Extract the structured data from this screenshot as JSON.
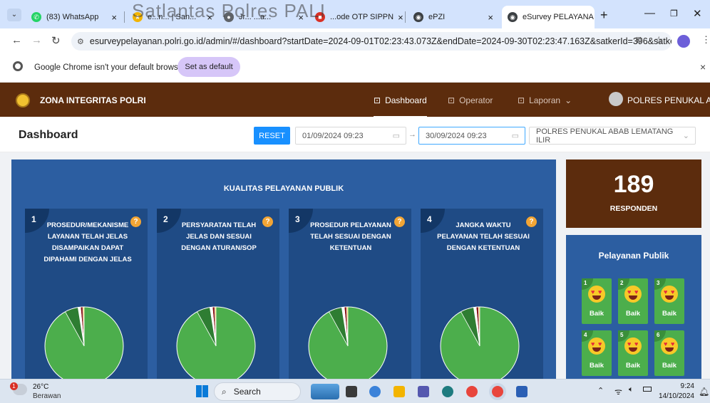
{
  "watermark": "Satlantas Polres PALI",
  "tabs": [
    {
      "title": "(83) WhatsApp",
      "color": "#25d366",
      "glyph": "✆"
    },
    {
      "title": "e...n... | San...",
      "color": "#f2b400",
      "glyph": "★"
    },
    {
      "title": "Jr... ...a...",
      "color": "#5f6368",
      "glyph": "●"
    },
    {
      "title": "...ode OTP SIPPN",
      "color": "#d93025",
      "glyph": "■"
    },
    {
      "title": "ePZI",
      "color": "#3c4043",
      "glyph": "◉"
    },
    {
      "title": "eSurvey PELAYANA",
      "color": "#3c4043",
      "glyph": "◉"
    }
  ],
  "new_tab": "+",
  "url": "esurveypelayanan.polri.go.id/admin/#/dashboard?startDate=2024-09-01T02:23:43.073Z&endDate=2024-09-30T02:23:47.163Z&satkerId=396&satkerNam...",
  "infobar": {
    "message": "Google Chrome isn't your default browser",
    "button": "Set as default"
  },
  "app": {
    "brand": "ZONA INTEGRITAS POLRI",
    "nav": [
      "Dashboard",
      "Operator",
      "Laporan"
    ],
    "user": "POLRES PENUKAL ABAB"
  },
  "dashboard": {
    "title": "Dashboard",
    "reset": "RESET",
    "start_date": "01/09/2024 09:23",
    "end_date": "30/09/2024 09:23",
    "unit": "POLRES PENUKAL ABAB LEMATANG ILIR",
    "panel_title": "KUALITAS PELAYANAN PUBLIK",
    "cards": [
      {
        "num": "1",
        "lines": [
          "PROSEDUR/MEKANISME",
          "LAYANAN TELAH JELAS",
          "DISAMPAIKAN DAPAT",
          "DIPAHAMI DENGAN JELAS"
        ]
      },
      {
        "num": "2",
        "lines": [
          "PERSYARATAN TELAH",
          "JELAS DAN SESUAI",
          "DENGAN ATURAN/SOP"
        ]
      },
      {
        "num": "3",
        "lines": [
          "PROSEDUR PELAYANAN",
          "TELAH SESUAI DENGAN",
          "KETENTUAN"
        ]
      },
      {
        "num": "4",
        "lines": [
          "JANGKA WAKTU",
          "PELAYANAN TELAH SESUAI",
          "DENGAN KETENTUAN"
        ]
      }
    ],
    "pie_colors": [
      "#4cae4c",
      "#2e7d32",
      "#ffffff",
      "#8b1a1a",
      "#f5c518"
    ],
    "pie_slices": [
      0.92,
      0.055,
      0.01,
      0.01,
      0.005
    ],
    "responden_count": "189",
    "responden_label": "RESPONDEN",
    "pelayanan_title": "Pelayanan Publik",
    "tiles": [
      {
        "num": "1",
        "label": "Baik"
      },
      {
        "num": "2",
        "label": "Baik"
      },
      {
        "num": "3",
        "label": "Baik"
      },
      {
        "num": "4",
        "label": "Baik"
      },
      {
        "num": "5",
        "label": "Baik"
      },
      {
        "num": "6",
        "label": "Baik"
      }
    ]
  },
  "taskbar": {
    "temp": "26°C",
    "weather": "Berawan",
    "weather_badge": "1",
    "search": "Search",
    "time": "9:24",
    "date": "14/10/2024"
  }
}
